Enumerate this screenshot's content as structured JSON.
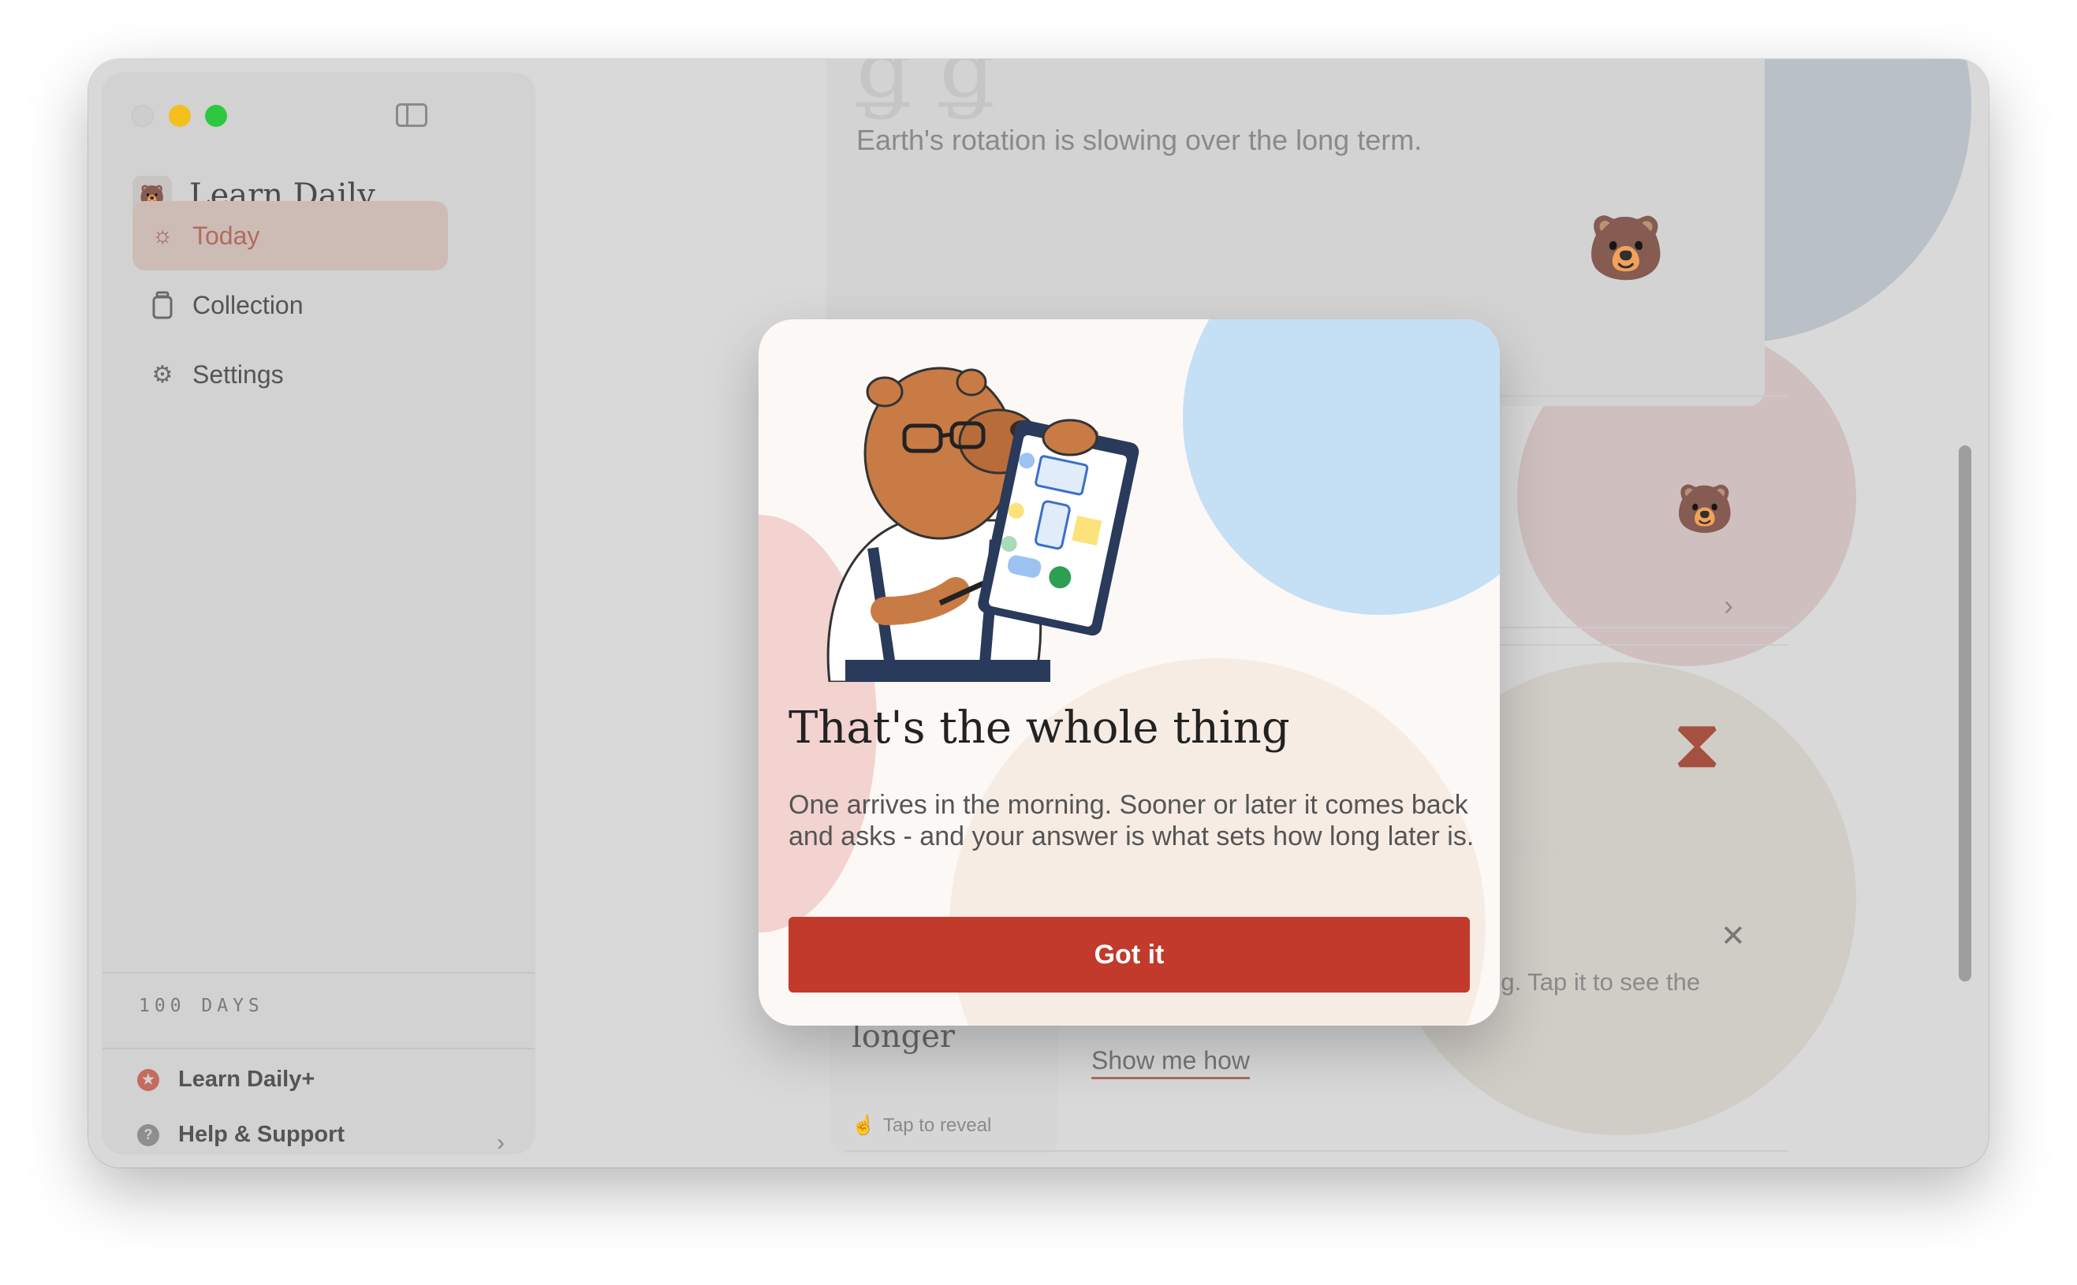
{
  "window": {
    "traffic_lights": [
      "close",
      "minimize",
      "maximize"
    ]
  },
  "sidebar": {
    "app_name": "Learn Daily",
    "items": [
      {
        "label": "Today",
        "icon": "sun-icon",
        "active": true
      },
      {
        "label": "Collection",
        "icon": "jar-icon",
        "active": false
      },
      {
        "label": "Settings",
        "icon": "gear-icon",
        "active": false
      }
    ],
    "streak_label": "100 DAYS",
    "footer": [
      {
        "label": "Learn Daily+",
        "icon": "star-badge-icon"
      },
      {
        "label": "Help & Support",
        "icon": "question-icon"
      }
    ]
  },
  "main": {
    "card_subtitle": "Earth's rotation is slowing over the long term.",
    "mini_card": {
      "title": "The day is getting longer",
      "hint": "Tap to reveal"
    },
    "tip": {
      "text": "Today's card waits there every morning. Tap it to see the meaning.",
      "link": "Show me how"
    }
  },
  "modal": {
    "title": "That's the whole thing",
    "body": "One arrives in the morning. Sooner or later it comes back and asks - and your answer is what sets how long later is.",
    "button": "Got it"
  },
  "colors": {
    "accent": "#c13a2b",
    "active_nav_bg": "#cdbcb6",
    "active_nav_text": "#b06c5d",
    "modal_blue": "#c5dff5",
    "modal_pink": "#f2d3cf"
  }
}
